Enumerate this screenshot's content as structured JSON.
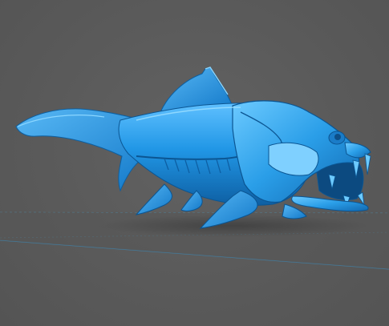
{
  "viewport": {
    "background_color": "#5b5b5b",
    "grid_color": "#4a8fb0",
    "model_color": "#1e90e0",
    "model_highlight": "#6cc8ff",
    "model_shadow": "#0d5a9a"
  },
  "model": {
    "icon": "dunkleosteus-fish-model"
  }
}
